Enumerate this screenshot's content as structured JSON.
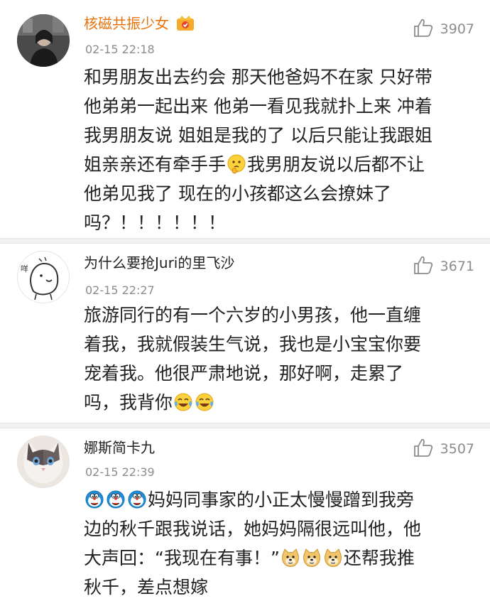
{
  "colors": {
    "vip_username": "#e8730d",
    "timestamp": "#8c8c8c",
    "divider": "#f1f1f1"
  },
  "comments": [
    {
      "username": "核磁共振少女",
      "vip_badge_icon": "vip-crown-icon",
      "timestamp": "02-15 22:18",
      "likes": "3907",
      "lines": [
        "和男朋友出去约会 那天他爸妈不在家 只好带",
        "他弟弟一起出来 他弟一看见我就扑上来 冲着",
        "我男朋友说 姐姐是我的了 以后只能让我跟姐",
        [
          "姐亲亲还有牵手手",
          "我男朋友说以后都不让"
        ],
        "他弟见我了 现在的小孩都这么会撩妹了",
        "吗？！！！！！！"
      ]
    },
    {
      "username": "为什么要抢Juri的里飞沙",
      "timestamp": "02-15 22:27",
      "likes": "3671",
      "lines": [
        "旅游同行的有一个六岁的小男孩，他一直缠",
        "着我，我就假装生气说，我也是小宝宝你要",
        "宠着我。他很严肃地说，那好啊，走累了",
        "吗，我背你"
      ]
    },
    {
      "username": "娜斯简卡九",
      "timestamp": "02-15 22:39",
      "likes": "3507",
      "lines": [
        "妈妈同事家的小正太慢慢蹭到我旁",
        "边的秋千跟我说话，她妈妈隔很远叫他，他",
        [
          "大声回：“我现在有事！”",
          "还帮我推"
        ],
        "秋千，差点想嫁"
      ]
    }
  ]
}
